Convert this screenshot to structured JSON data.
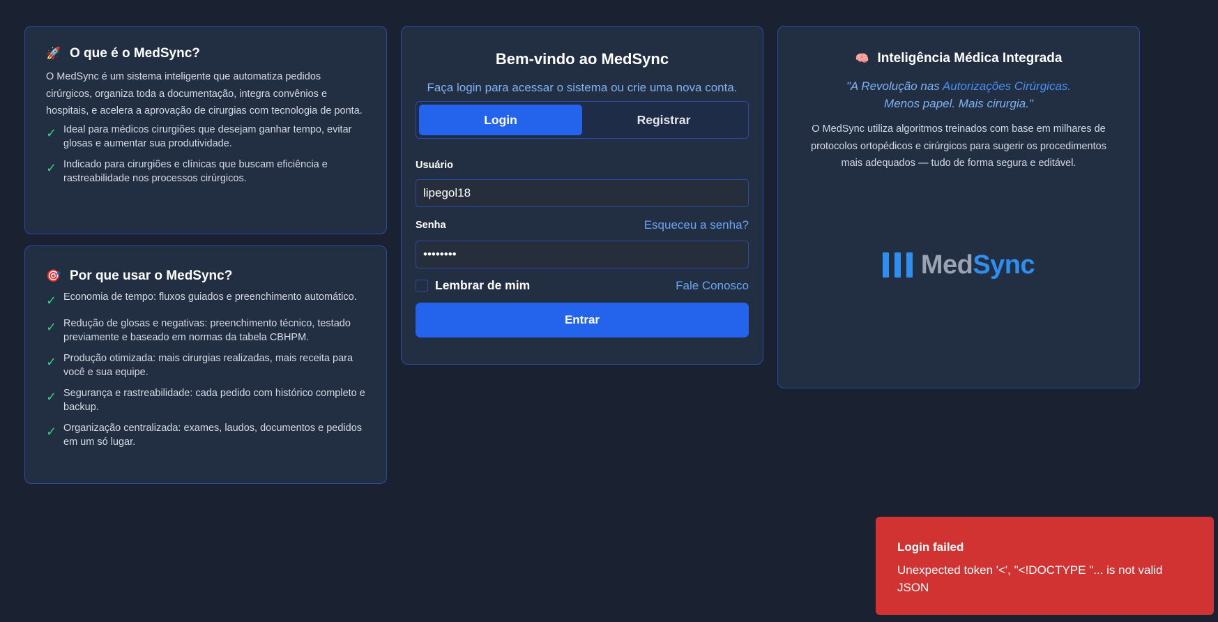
{
  "what_card": {
    "emoji": "🚀",
    "title": "O que é o MedSync?",
    "description": "O MedSync é um sistema inteligente que automatiza pedidos cirúrgicos, organiza toda a documentação, integra convênios e hospitais, e acelera a aprovação de cirurgias com tecnologia de ponta.",
    "items": [
      "Ideal para médicos cirurgiões que desejam ganhar tempo, evitar glosas e aumentar sua produtividade.",
      "Indicado para cirurgiões e clínicas que buscam eficiência e rastreabilidade nos processos cirúrgicos."
    ]
  },
  "why_card": {
    "emoji": "🎯",
    "title": "Por que usar o MedSync?",
    "items": [
      "Economia de tempo: fluxos guiados e preenchimento automático.",
      "Redução de glosas e negativas: preenchimento técnico, testado previamente e baseado em normas da tabela CBHPM.",
      "Produção otimizada: mais cirurgias realizadas, mais receita para você e sua equipe.",
      "Segurança e rastreabilidade: cada pedido com histórico completo e backup.",
      "Organização centralizada: exames, laudos, documentos e pedidos em um só lugar."
    ]
  },
  "login": {
    "title": "Bem-vindo ao MedSync",
    "subtitle": "Faça login para acessar o sistema ou crie uma nova conta.",
    "tabs": {
      "login": "Login",
      "register": "Registrar",
      "active": "login"
    },
    "username_label": "Usuário",
    "username_value": "lipegol18",
    "password_label": "Senha",
    "password_value": "••••••••",
    "forgot_link": "Esqueceu a senha?",
    "remember_label": "Lembrar de mim",
    "remember_checked": false,
    "contact_link": "Fale Conosco",
    "submit_label": "Entrar"
  },
  "ai_card": {
    "emoji": "🧠",
    "title": "Inteligência Médica Integrada",
    "quote": {
      "part1": "\"A Revolução nas ",
      "highlight": "Autorizações Cirúrgicas.",
      "part2": "Menos papel. Mais cirurgia.\""
    },
    "description": "O MedSync utiliza algoritmos treinados com base em milhares de protocolos ortopédicos e cirúrgicos para sugerir os procedimentos mais adequados — tudo de forma segura e editável.",
    "logo": {
      "part1": "Med",
      "part2": "Sync"
    }
  },
  "toast": {
    "title": "Login failed",
    "message": "Unexpected token '<', \"<!DOCTYPE \"... is not valid JSON"
  },
  "colors": {
    "background": "#1a2130",
    "card": "#222f42",
    "border": "#2c4ba8",
    "primary": "#2463eb",
    "link": "#6aa4f5",
    "check": "#34d27a",
    "error": "#d13232"
  },
  "icons": {
    "check": "check-icon",
    "what": "rocket-icon",
    "why": "target-icon",
    "ai": "brain-icon"
  }
}
